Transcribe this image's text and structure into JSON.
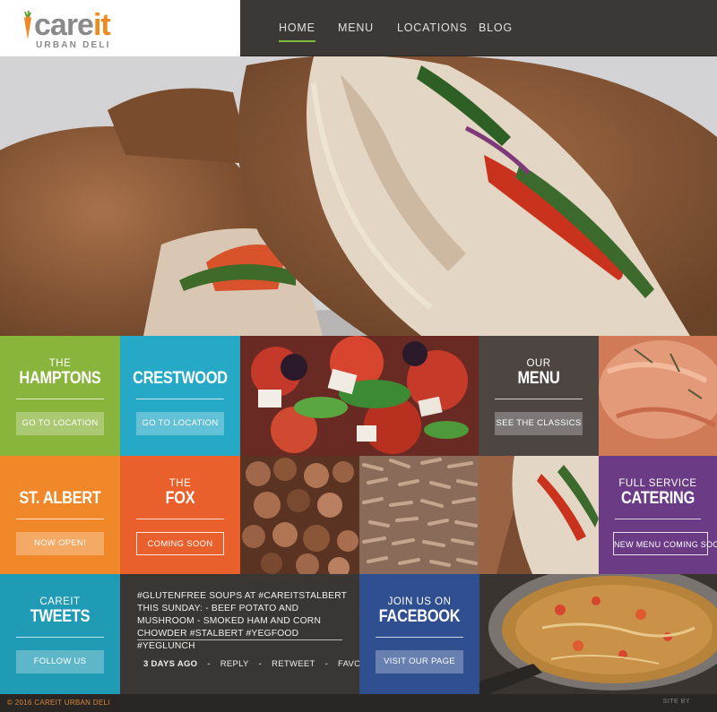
{
  "logo": {
    "word_part1": "care",
    "word_part2": "it",
    "tagline": "URBAN DELI"
  },
  "nav": {
    "items": [
      "HOME",
      "MENU",
      "LOCATIONS",
      "BLOG"
    ],
    "active": "HOME"
  },
  "tiles": {
    "hamptons": {
      "small": "THE",
      "big": "HAMPTONS",
      "button": "GO TO LOCATION",
      "color": "#8ab53c"
    },
    "crestwood": {
      "big": "CRESTWOOD",
      "button": "GO TO LOCATION",
      "color": "#26a9c6"
    },
    "menu": {
      "small": "OUR",
      "big": "MENU",
      "button": "SEE THE CLASSICS",
      "color": "#4c4542"
    },
    "st_albert": {
      "big": "ST. ALBERT",
      "button": "NOW OPEN!",
      "color": "#f0882a"
    },
    "fox": {
      "small": "THE",
      "big": "FOX",
      "button": "COMING SOON",
      "color": "#e9602c"
    },
    "catering": {
      "small": "FULL SERVICE",
      "big": "CATERING",
      "button": "NEW MENU COMING SOON",
      "color": "#6b3b86"
    },
    "tweets": {
      "small": "CAREIT",
      "big": "TWEETS",
      "button": "FOLLOW US",
      "color": "#1f9bb5"
    },
    "facebook": {
      "small": "JOIN US ON",
      "big": "FACEBOOK",
      "button": "VISIT OUR PAGE",
      "color": "#2f4f91"
    }
  },
  "tweet": {
    "text": "#GLUTENFREE SOUPS AT #CAREITSTALBERT THIS SUNDAY: - BEEF POTATO AND MUSHROOM - SMOKED HAM AND CORN CHOWDER #STALBERT #YEGFOOD #YEGLUNCH",
    "time": "3 DAYS AGO",
    "reply": "REPLY",
    "retweet": "RETWEET",
    "favourite": "FAVOURITE",
    "separator": "-"
  },
  "footer": {
    "copyright": "© 2016 CAREIT URBAN DELI",
    "site_by": "SITE BY"
  },
  "colors": {
    "accent_green": "#7cb83b",
    "nav_bg": "#3b3836",
    "copyright": "#d8883a"
  }
}
